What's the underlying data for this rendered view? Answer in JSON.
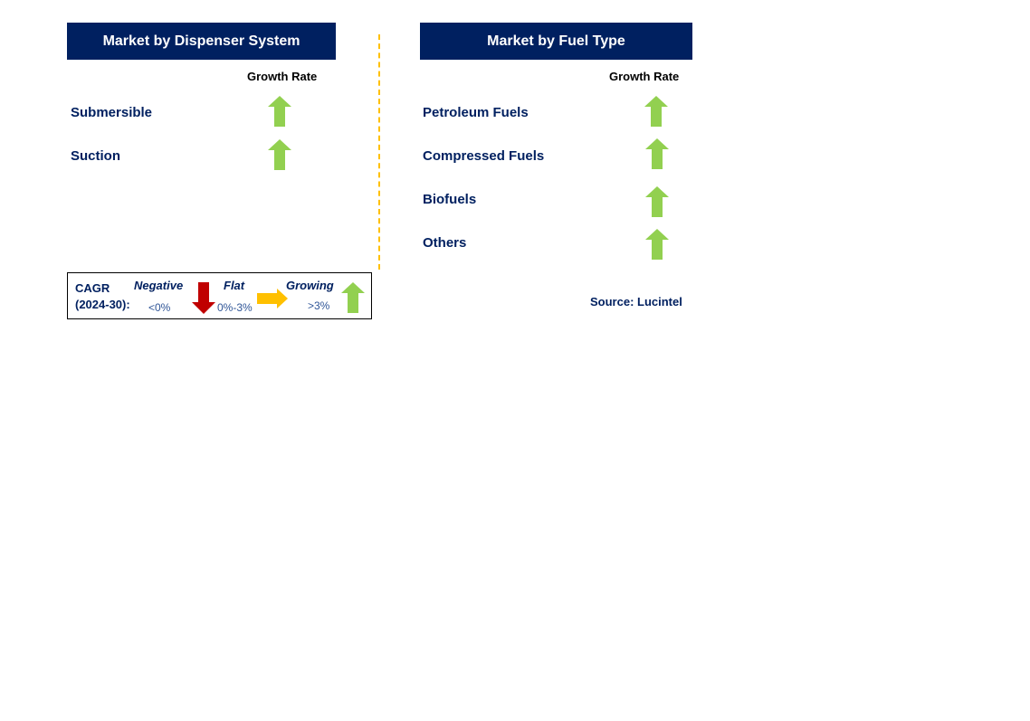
{
  "left_panel": {
    "title": "Market by Dispenser System",
    "column_header": "Growth Rate",
    "rows": [
      {
        "label": "Submersible",
        "trend": "growing"
      },
      {
        "label": "Suction",
        "trend": "growing"
      }
    ]
  },
  "right_panel": {
    "title": "Market by Fuel Type",
    "column_header": "Growth Rate",
    "rows": [
      {
        "label": "Petroleum Fuels",
        "trend": "growing"
      },
      {
        "label": "Compressed Fuels",
        "trend": "growing"
      },
      {
        "label": "Biofuels",
        "trend": "growing"
      },
      {
        "label": "Others",
        "trend": "growing"
      }
    ]
  },
  "legend": {
    "title_line1": "CAGR",
    "title_line2": "(2024-30):",
    "negative": {
      "label": "Negative",
      "range": "<0%",
      "icon": "arrow-down-icon",
      "color": "#C00000"
    },
    "flat": {
      "label": "Flat",
      "range": "0%-3%",
      "icon": "arrow-right-icon",
      "color": "#FFC000"
    },
    "growing": {
      "label": "Growing",
      "range": ">3%",
      "icon": "arrow-up-icon",
      "color": "#92D050"
    }
  },
  "source": "Source: Lucintel",
  "colors": {
    "header_bg": "#002060",
    "growing": "#92D050",
    "divider": "#FFC000"
  }
}
